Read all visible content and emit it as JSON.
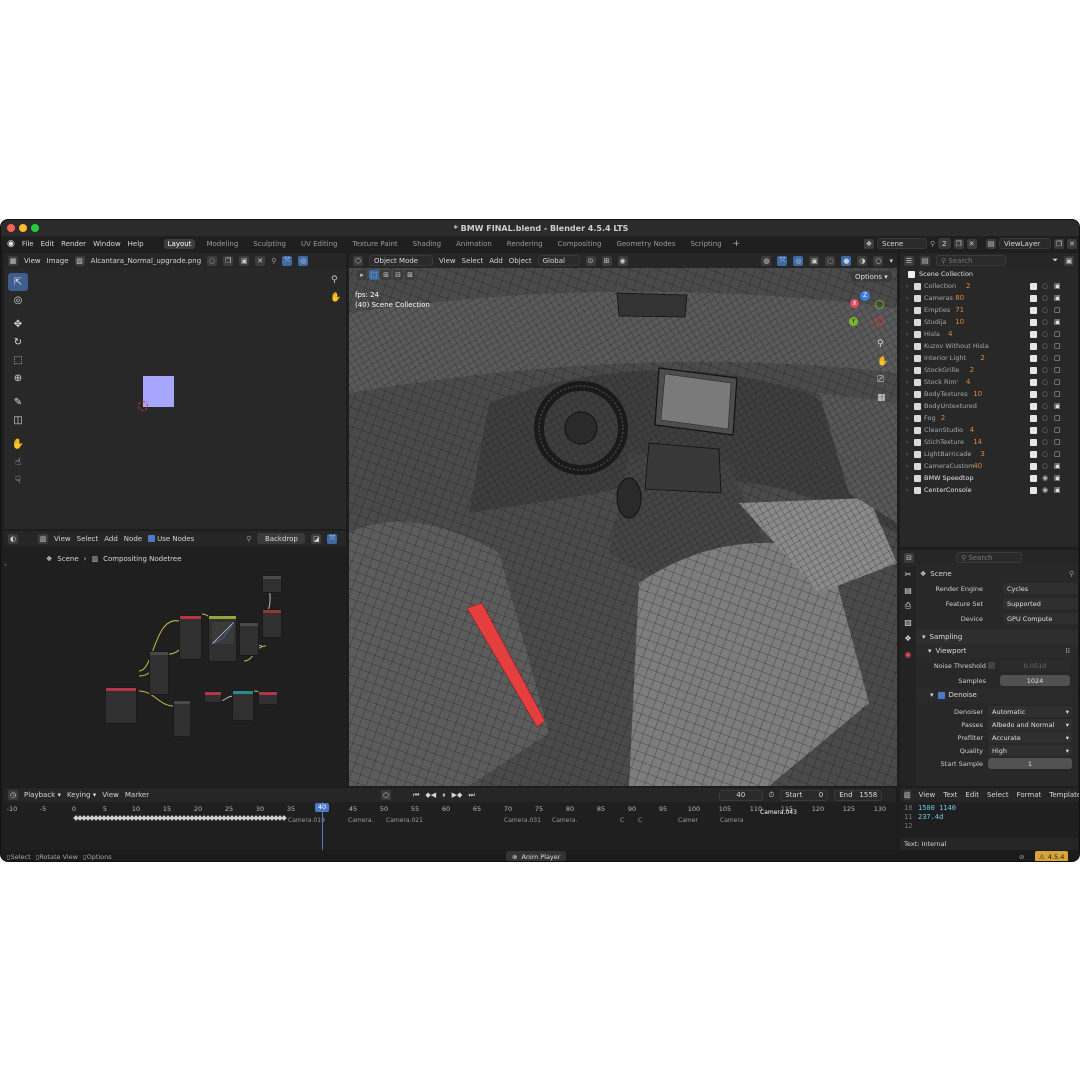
{
  "window": {
    "title": "* BMW FINAL.blend - Blender 4.5.4 LTS",
    "colors": {
      "bg": "#1d1d1d",
      "accent": "#3e6aa6",
      "orange": "#d88b3a",
      "current_frame": "#4a7ac8"
    }
  },
  "menu": [
    "File",
    "Edit",
    "Render",
    "Window",
    "Help"
  ],
  "workspaces": [
    "Layout",
    "Modeling",
    "Sculpting",
    "UV Editing",
    "Texture Paint",
    "Shading",
    "Animation",
    "Rendering",
    "Compositing",
    "Geometry Nodes",
    "Scripting"
  ],
  "scene": {
    "name": "Scene",
    "count": "2",
    "view_layer": "ViewLayer"
  },
  "image_editor": {
    "menus": [
      "View",
      "Image"
    ],
    "image_name": "Alcantara_Normal_upgrade.png"
  },
  "node_editor": {
    "menus": [
      "View",
      "Select",
      "Add",
      "Node"
    ],
    "use_nodes_label": "Use Nodes",
    "backdrop_label": "Backdrop",
    "breadcrumb_scene": "Scene",
    "breadcrumb_tree": "Compositing Nodetree"
  },
  "viewport": {
    "mode": "Object Mode",
    "menus": [
      "View",
      "Select",
      "Add",
      "Object"
    ],
    "orientation": "Global",
    "options_label": "Options",
    "fps": "fps: 24",
    "collection": "(40) Scene Collection"
  },
  "outliner": {
    "search_placeholder": "Search",
    "root": "Scene Collection",
    "items": [
      {
        "name": "Collection",
        "count": "2",
        "camera": true,
        "eye": false
      },
      {
        "name": "Cameras",
        "count": "80",
        "camera": true,
        "eye": false
      },
      {
        "name": "Empties",
        "count": "71",
        "camera": false,
        "eye": false
      },
      {
        "name": "Studija",
        "count": "10",
        "camera": true,
        "eye": false
      },
      {
        "name": "Hisla",
        "count": "4",
        "camera": false,
        "eye": false
      },
      {
        "name": "Kuzov Without Hisla",
        "count": "",
        "camera": false,
        "eye": false
      },
      {
        "name": "Interior Light",
        "count": "2",
        "camera": false,
        "eye": false
      },
      {
        "name": "StockGrille",
        "count": "2",
        "camera": false,
        "eye": false
      },
      {
        "name": "Stock Rim'",
        "count": "4",
        "camera": false,
        "eye": false
      },
      {
        "name": "BodyTextures",
        "count": "10",
        "camera": false,
        "eye": false
      },
      {
        "name": "BodyUntextured",
        "count": "",
        "camera": true,
        "eye": false
      },
      {
        "name": "Fog",
        "count": "2",
        "camera": false,
        "eye": false
      },
      {
        "name": "CleanStudio",
        "count": "4",
        "camera": false,
        "eye": false
      },
      {
        "name": "StichTexture",
        "count": "14",
        "camera": false,
        "eye": false
      },
      {
        "name": "LightBarricade",
        "count": "3",
        "camera": false,
        "eye": false
      },
      {
        "name": "CameraCustom",
        "count": "40",
        "camera": true,
        "eye": false
      },
      {
        "name": "BMW Speedtop",
        "count": "",
        "camera": true,
        "eye": true
      },
      {
        "name": "CenterConsole",
        "count": "",
        "camera": true,
        "eye": true
      }
    ]
  },
  "properties": {
    "search_placeholder": "Search",
    "context": "Scene",
    "render_engine_label": "Render Engine",
    "render_engine": "Cycles",
    "feature_set_label": "Feature Set",
    "feature_set": "Supported",
    "device_label": "Device",
    "device": "GPU Compute",
    "sampling_label": "Sampling",
    "viewport_label": "Viewport",
    "noise_threshold_label": "Noise Threshold",
    "noise_threshold": "0.0510",
    "samples_label": "Samples",
    "samples": "1024",
    "denoise_label": "Denoise",
    "denoiser_label": "Denoiser",
    "denoiser": "Automatic",
    "passes_label": "Passes",
    "passes": "Albedo and Normal",
    "prefilter_label": "Prefilter",
    "prefilter": "Accurate",
    "quality_label": "Quality",
    "quality": "High",
    "start_sample_label": "Start Sample",
    "start_sample": "1"
  },
  "timeline": {
    "menus": [
      "Playback",
      "Keying",
      "View",
      "Marker"
    ],
    "current_frame": "40",
    "start_label": "Start",
    "start": "0",
    "end_label": "End",
    "end": "1558",
    "ticks": [
      "-10",
      "-5",
      "0",
      "5",
      "10",
      "15",
      "20",
      "25",
      "30",
      "35",
      "40",
      "45",
      "50",
      "55",
      "60",
      "65",
      "70",
      "75",
      "80",
      "85",
      "90",
      "95",
      "100",
      "105",
      "110",
      "115",
      "120",
      "125",
      "130"
    ],
    "markers": [
      "Camera.019",
      "Camera.",
      "Camera.021",
      "Camera.031",
      "Camera.",
      "C",
      "C",
      "Camer",
      "Camera",
      "Camera.043"
    ]
  },
  "text_editor": {
    "menus": [
      "View",
      "Text",
      "Edit",
      "Select",
      "Format",
      "Templates"
    ],
    "lines": [
      {
        "num": "10",
        "code": "1500  1140"
      },
      {
        "num": "11",
        "code": "237.4d"
      },
      {
        "num": "12",
        "code": ""
      }
    ],
    "status": "Text: Internal"
  },
  "statusbar": {
    "select": "Select",
    "rotate": "Rotate View",
    "options": "Options",
    "anim_player": "Anim Player",
    "version": "4.5.4"
  }
}
